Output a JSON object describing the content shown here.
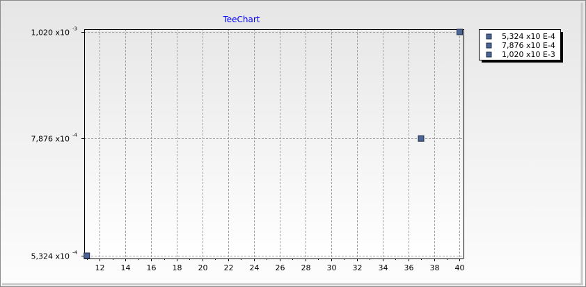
{
  "chart_data": {
    "type": "scatter",
    "title": "TeeChart",
    "xlabel": "",
    "ylabel": "",
    "xlim": [
      10.8,
      40.3
    ],
    "ylim": [
      0.0005324,
      0.00102
    ],
    "x_ticks": [
      12,
      14,
      16,
      18,
      20,
      22,
      24,
      26,
      28,
      30,
      32,
      34,
      36,
      38,
      40
    ],
    "y_ticks": [
      {
        "value": 0.0005324,
        "mantissa": "5,324 x10",
        "exponent": "-4"
      },
      {
        "value": 0.0007876,
        "mantissa": "7,876 x10",
        "exponent": "-4"
      },
      {
        "value": 0.00102,
        "mantissa": "1,020 x10",
        "exponent": "-3"
      }
    ],
    "grid": true,
    "legend_position": "right",
    "series": [
      {
        "points": [
          {
            "x": 11,
            "y": 0.0005324
          },
          {
            "x": 37,
            "y": 0.0007876
          },
          {
            "x": 40,
            "y": 0.00102
          }
        ]
      }
    ],
    "legend": [
      "5,324 x10 E-4",
      "7,876 x10 E-4",
      "1,020 x10 E-3"
    ],
    "colors": {
      "marker_fill": "#4a6496",
      "marker_stroke": "#1e2a44",
      "title": "#0000ff",
      "grid": "#a0a0a0"
    }
  }
}
